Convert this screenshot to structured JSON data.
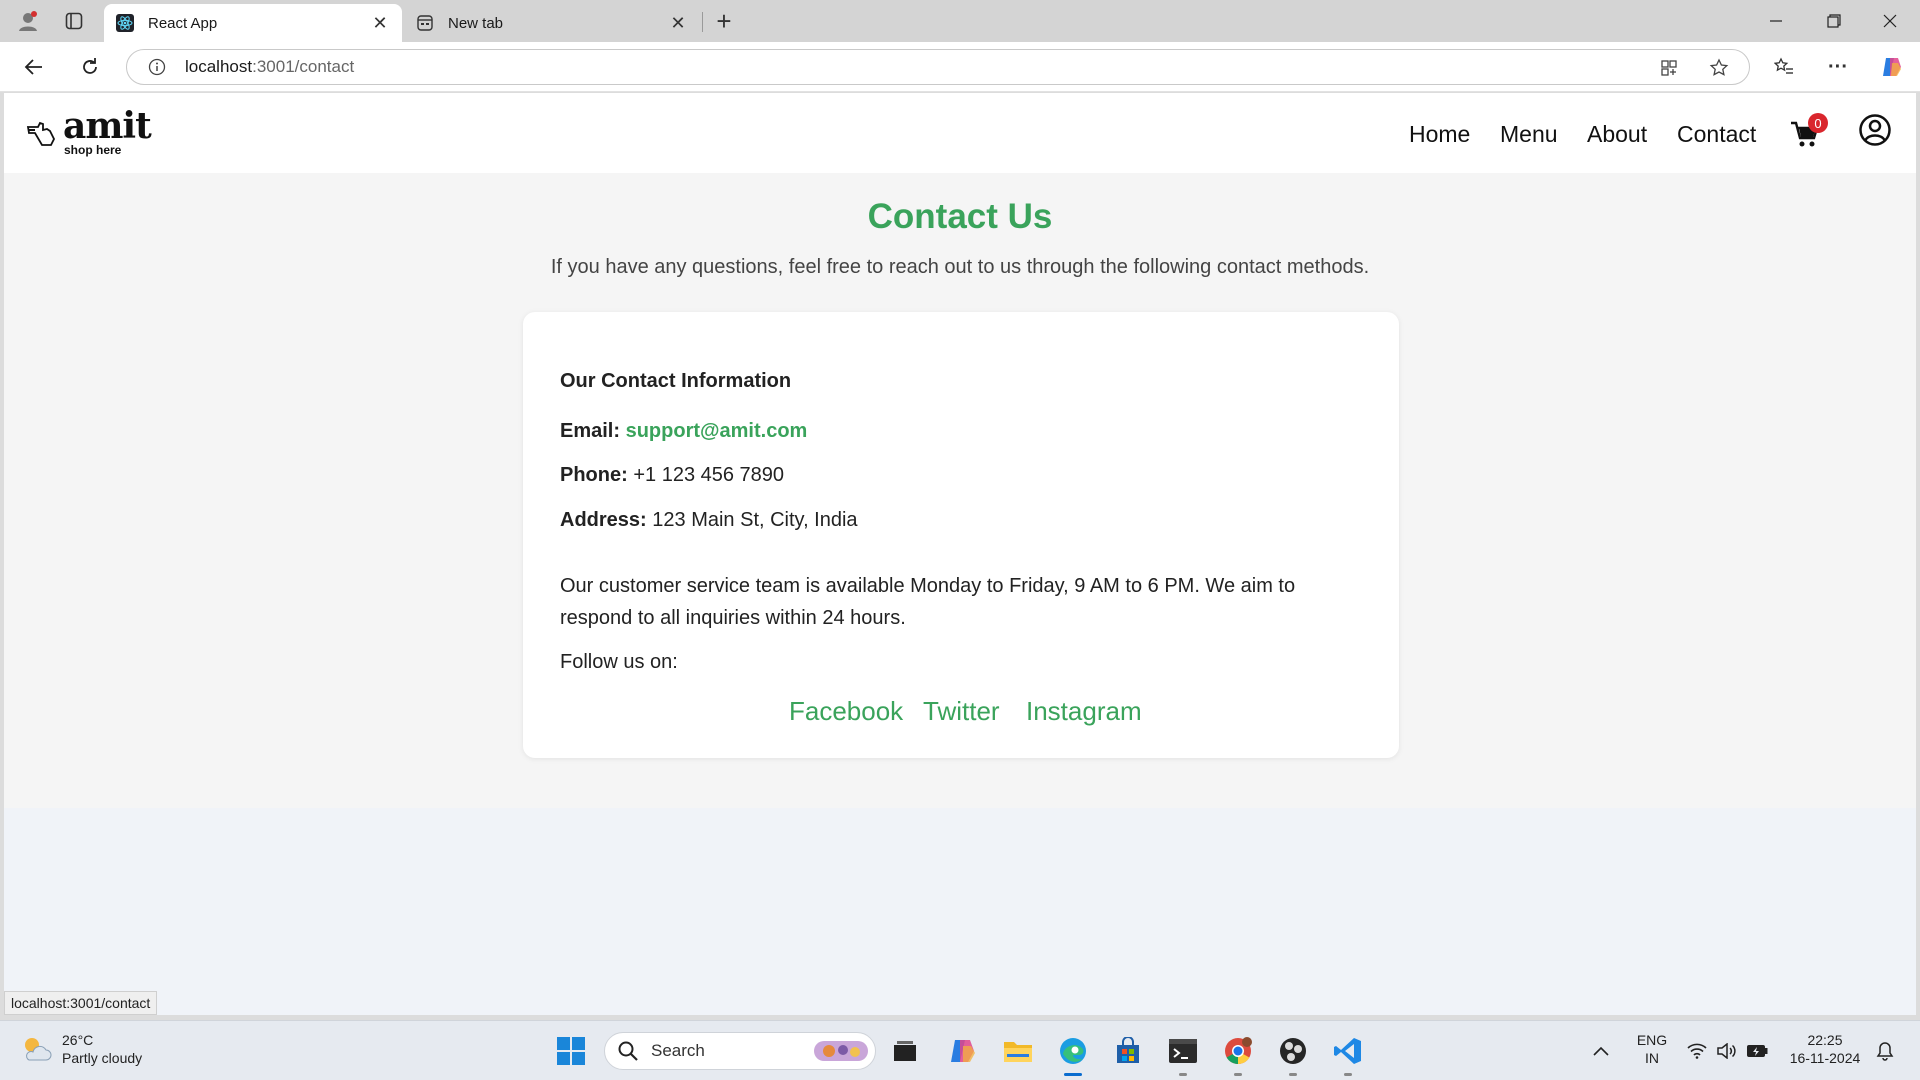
{
  "browser": {
    "tabs": [
      {
        "label": "React App",
        "active": true
      },
      {
        "label": "New tab",
        "active": false
      }
    ],
    "url_host": "localhost",
    "url_path": ":3001/contact",
    "status_url": "localhost:3001/contact"
  },
  "site": {
    "logo_word": "amit",
    "logo_tagline": "shop here",
    "nav": [
      "Home",
      "Menu",
      "About",
      "Contact"
    ],
    "cart_count": "0"
  },
  "contact": {
    "title": "Contact Us",
    "subtitle": "If you have any questions, feel free to reach out to us through the following contact methods.",
    "heading": "Our Contact Information",
    "email_label": "Email:",
    "email_value": "support@amit.com",
    "phone_label": "Phone:",
    "phone_value": "+1 123 456 7890",
    "address_label": "Address:",
    "address_value": "123 Main St, City, India",
    "hours_text": "Our customer service team is available Monday to Friday, 9 AM to 6 PM. We aim to respond to all inquiries within 24 hours.",
    "follow_text": "Follow us on:",
    "social": [
      "Facebook",
      "Twitter",
      "Instagram"
    ]
  },
  "taskbar": {
    "weather_temp": "26°C",
    "weather_desc": "Partly cloudy",
    "search_label": "Search",
    "lang_top": "ENG",
    "lang_bottom": "IN",
    "time": "22:25",
    "date": "16-11-2024"
  },
  "colors": {
    "accent_green": "#3aa35b",
    "badge_red": "#d9262d",
    "edge_blue": "#0a6ccf"
  }
}
